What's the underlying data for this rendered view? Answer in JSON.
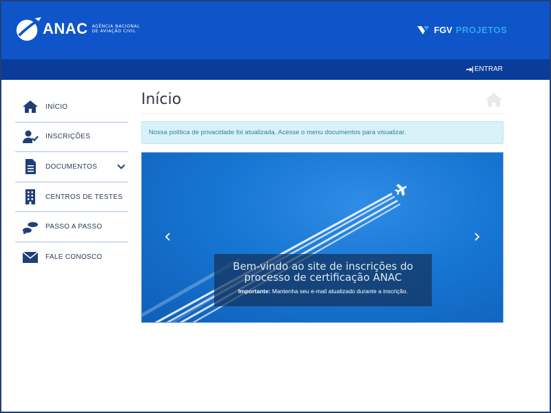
{
  "header": {
    "logo_text": "ANAC",
    "logo_sub_line1": "AGÊNCIA NACIONAL",
    "logo_sub_line2": "DE AVIAÇÃO CIVIL",
    "partner_a": "FGV",
    "partner_b": "PROJETOS",
    "login_label": "ENTRAR",
    "colors": {
      "primary": "#0f55c9",
      "secondary": "#0a3c9a",
      "accent": "#29a8f3"
    }
  },
  "sidebar": {
    "items": [
      {
        "label": "INÍCIO",
        "icon": "home-icon"
      },
      {
        "label": "INSCRIÇÕES",
        "icon": "user-check-icon"
      },
      {
        "label": "DOCUMENTOS",
        "icon": "document-icon",
        "has_submenu": true
      },
      {
        "label": "CENTROS DE TESTES",
        "icon": "building-icon"
      },
      {
        "label": "PASSO A PASSO",
        "icon": "footsteps-icon"
      },
      {
        "label": "FALE CONOSCO",
        "icon": "envelope-icon"
      }
    ]
  },
  "main": {
    "title": "Início",
    "alert": "Nossa política de privacidade foi atualizada. Acesse o menu documentos para visualizar.",
    "carousel": {
      "caption_title_line1": "Bem-vindo ao site de inscrições do",
      "caption_title_line2": "processo de certificação ANAC",
      "caption_note_label": "Importante:",
      "caption_note_text": "Mantenha seu e-mail atualizado durante a inscrição."
    }
  }
}
